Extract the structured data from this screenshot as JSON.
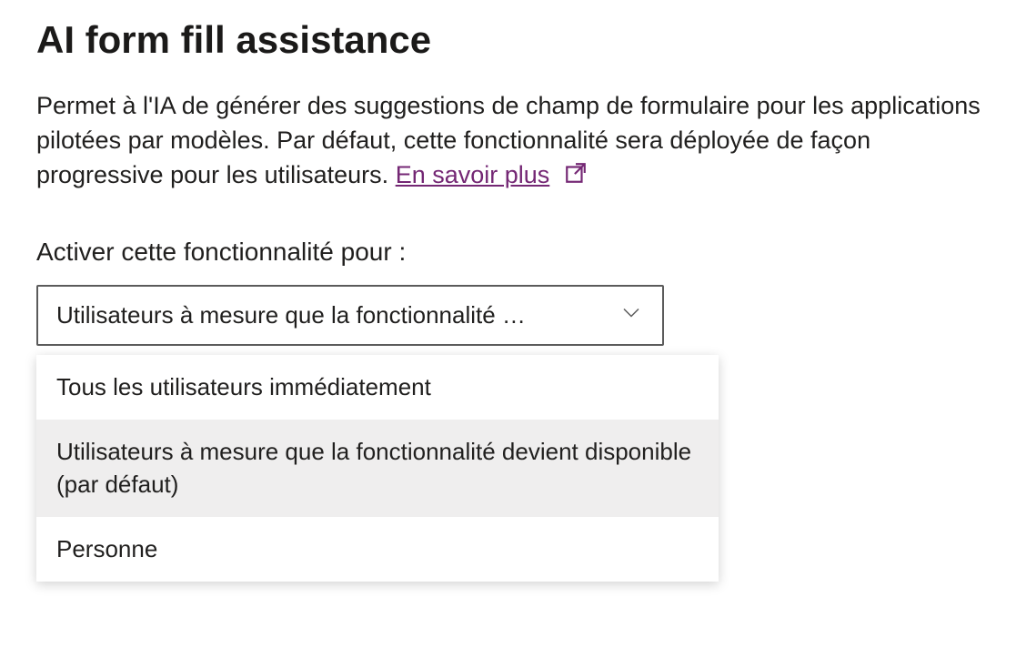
{
  "title": "AI form fill assistance",
  "description_text": "Permet à l'IA de générer des suggestions de champ de formulaire pour les applications pilotées par modèles. Par défaut, cette fonctionnalité sera déployée de façon progressive pour les utilisateurs. ",
  "learn_more_label": "En savoir plus",
  "field_label": "Activer cette fonctionnalité pour :",
  "dropdown": {
    "selected_display": "Utilisateurs à mesure que la fonctionnalité …",
    "options": [
      {
        "label": "Tous les utilisateurs immédiatement",
        "selected": false
      },
      {
        "label": "Utilisateurs à mesure que la fonctionnalité devient disponible (par défaut)",
        "selected": true
      },
      {
        "label": "Personne",
        "selected": false
      }
    ]
  },
  "colors": {
    "link": "#742774",
    "text": "#201f1e",
    "border": "#5b5b5b"
  }
}
